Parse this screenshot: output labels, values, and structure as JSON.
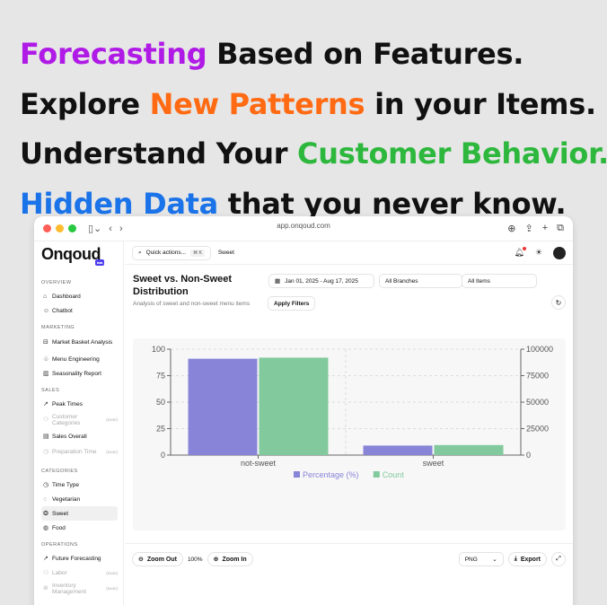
{
  "headlines": {
    "line1": {
      "highlight": "Forecasting",
      "rest": " Based on Features."
    },
    "line2": {
      "pre": "Explore ",
      "highlight": "New Patterns",
      "rest": " in your Items."
    },
    "line3": {
      "pre": "Understand Your ",
      "highlight": "Customer Behavior."
    },
    "line4": {
      "highlight": "Hidden Data",
      "rest": " that you never know."
    }
  },
  "colors": {
    "purple": "#b01ae6",
    "orange": "#ff6a13",
    "green": "#2db83d",
    "blue": "#1a73e8",
    "bar_percentage": "#8884d8",
    "bar_count": "#82ca9d"
  },
  "browser": {
    "url": "app.onqoud.com"
  },
  "app": {
    "logo": "Onqoud",
    "logo_badge": "beta"
  },
  "topbar": {
    "quick_actions": "Quick actions...",
    "shortcut": "⌘ K",
    "breadcrumb": "Sweet"
  },
  "sidebar": {
    "overview": {
      "heading": "OVERVIEW",
      "items": [
        "Dashboard",
        "Chatbot"
      ]
    },
    "marketing": {
      "heading": "MARKETING",
      "items": [
        "Market Basket Analysis",
        "Menu Engineering",
        "Seasonality Report"
      ]
    },
    "sales": {
      "heading": "SALES",
      "items": [
        "Peak Times",
        "Customer Categories",
        "Sales Overall",
        "Preparation Time"
      ],
      "soon": "(soon)"
    },
    "categories": {
      "heading": "CATEGORIES",
      "items": [
        "Time Type",
        "Vegetarian",
        "Sweet",
        "Food"
      ]
    },
    "operations": {
      "heading": "OPERATIONS",
      "items": [
        "Future Forecasting",
        "Labor",
        "Inventory Management"
      ]
    }
  },
  "page": {
    "title": "Sweet vs. Non-Sweet Distribution",
    "subtitle": "Analysis of sweet and non-sweet menu items",
    "date_range": "Jan 01, 2025 - Aug 17, 2025",
    "branches": "All Branches",
    "items": "All Items",
    "apply": "Apply Filters"
  },
  "chart_data": {
    "type": "bar",
    "categories": [
      "not-sweet",
      "sweet"
    ],
    "series": [
      {
        "name": "Percentage (%)",
        "axis": "left",
        "values": [
          91,
          9
        ]
      },
      {
        "name": "Count",
        "axis": "right",
        "values": [
          92000,
          9500
        ]
      }
    ],
    "ylim_left": [
      0,
      100
    ],
    "ylim_right": [
      0,
      100000
    ],
    "yticks_left": [
      "0",
      "25",
      "50",
      "75",
      "100"
    ],
    "yticks_right": [
      "0",
      "25000",
      "50000",
      "75000",
      "100000"
    ],
    "legend_position": "bottom",
    "grid": true
  },
  "bottom": {
    "zoom_out": "Zoom Out",
    "zoom_level": "100%",
    "zoom_in": "Zoom In",
    "format": "PNG",
    "export": "Export"
  }
}
